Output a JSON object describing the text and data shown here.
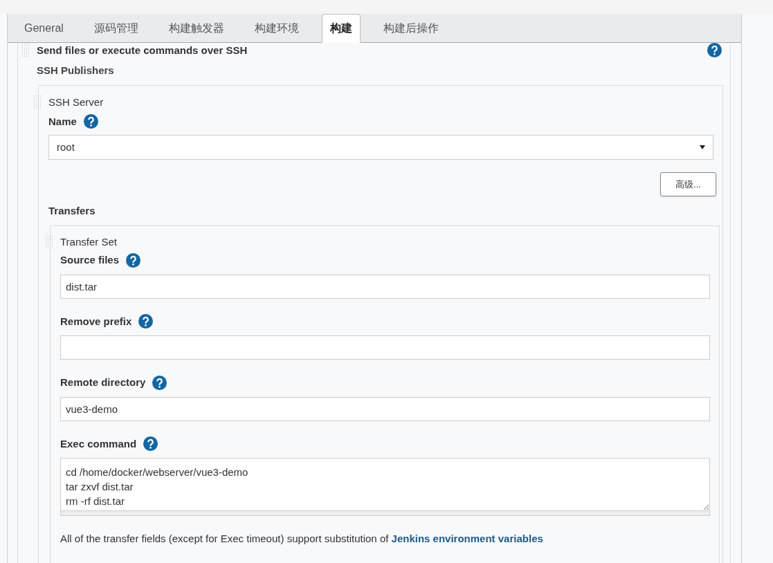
{
  "tabs": [
    {
      "label": "General",
      "selected": false
    },
    {
      "label": "源码管理",
      "selected": false
    },
    {
      "label": "构建触发器",
      "selected": false
    },
    {
      "label": "构建环境",
      "selected": false
    },
    {
      "label": "构建",
      "selected": true
    },
    {
      "label": "构建后操作",
      "selected": false
    }
  ],
  "section": {
    "title": "Send files or execute commands over SSH",
    "subtitle": "SSH Publishers"
  },
  "server": {
    "heading": "SSH Server",
    "name_label": "Name",
    "name_value": "root",
    "advanced_button": "高级...",
    "transfers_label": "Transfers"
  },
  "transfer_set": {
    "heading": "Transfer Set",
    "fields": [
      {
        "kind": "input",
        "label": "Source files",
        "value": "dist.tar"
      },
      {
        "kind": "input",
        "label": "Remove prefix"
      },
      {
        "kind": "input",
        "label": "Remote directory",
        "value": "vue3-demo"
      },
      {
        "kind": "textarea",
        "label": "Exec command",
        "value": "cd /home/docker/webserver/vue3-demo\ntar zxvf dist.tar\nrm -rf dist.tar"
      }
    ]
  },
  "note": {
    "text": "All of the transfer fields (except for Exec timeout) support substitution of ",
    "link": "Jenkins environment variables"
  }
}
